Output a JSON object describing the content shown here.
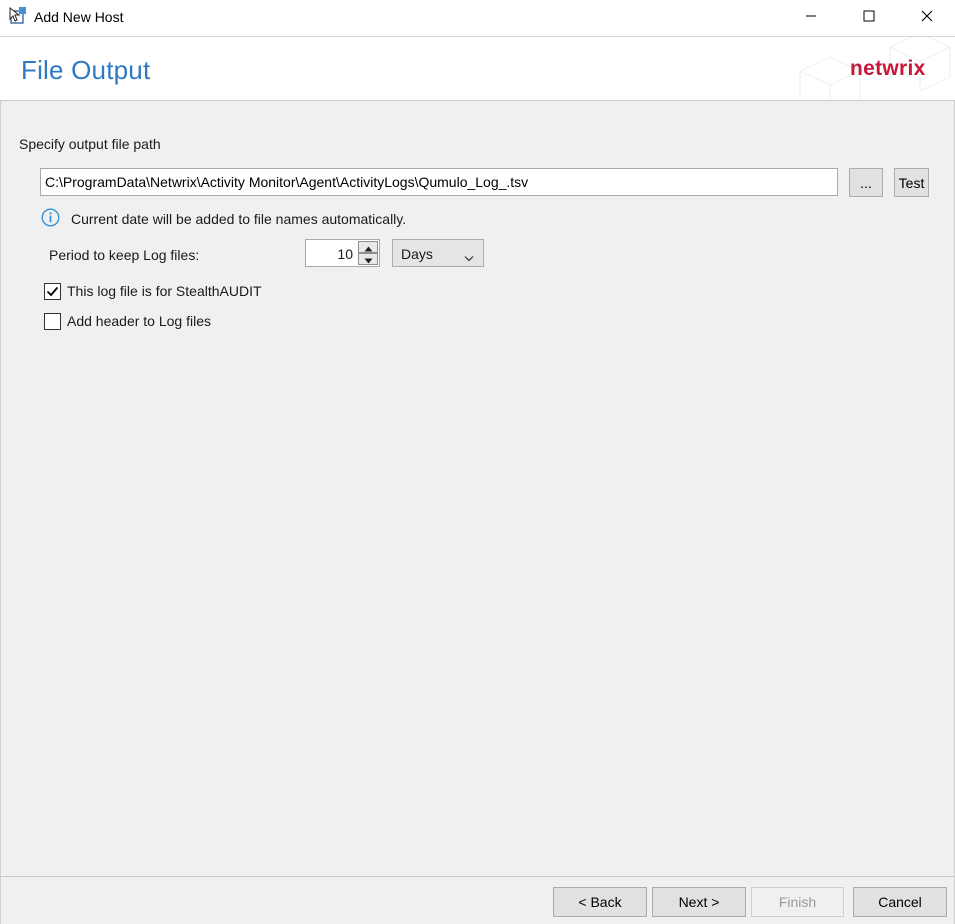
{
  "window": {
    "title": "Add New Host",
    "icon": "add-host-icon",
    "controls": [
      "minimize-icon",
      "maximize-icon",
      "close-icon"
    ]
  },
  "header": {
    "page_title": "File Output",
    "logo_text": "netwrix",
    "title_color": "#2f79c4",
    "logo_color": "#c7183a"
  },
  "form": {
    "path_label": "Specify output file path",
    "path_value": "C:\\ProgramData\\Netwrix\\Activity Monitor\\Agent\\ActivityLogs\\Qumulo_Log_.tsv",
    "browse_label": "...",
    "test_label": "Test",
    "info_text": "Current date will be added to file names automatically.",
    "period_label": "Period to keep Log files:",
    "period_value": "10",
    "period_unit": "Days",
    "stealthaudit_label": "This log file is for StealthAUDIT",
    "stealthaudit_checked": true,
    "header_label": "Add header to Log files",
    "header_checked": false
  },
  "footer": {
    "back_label": "< Back",
    "next_label": "Next >",
    "finish_label": "Finish",
    "finish_enabled": false,
    "cancel_label": "Cancel"
  }
}
